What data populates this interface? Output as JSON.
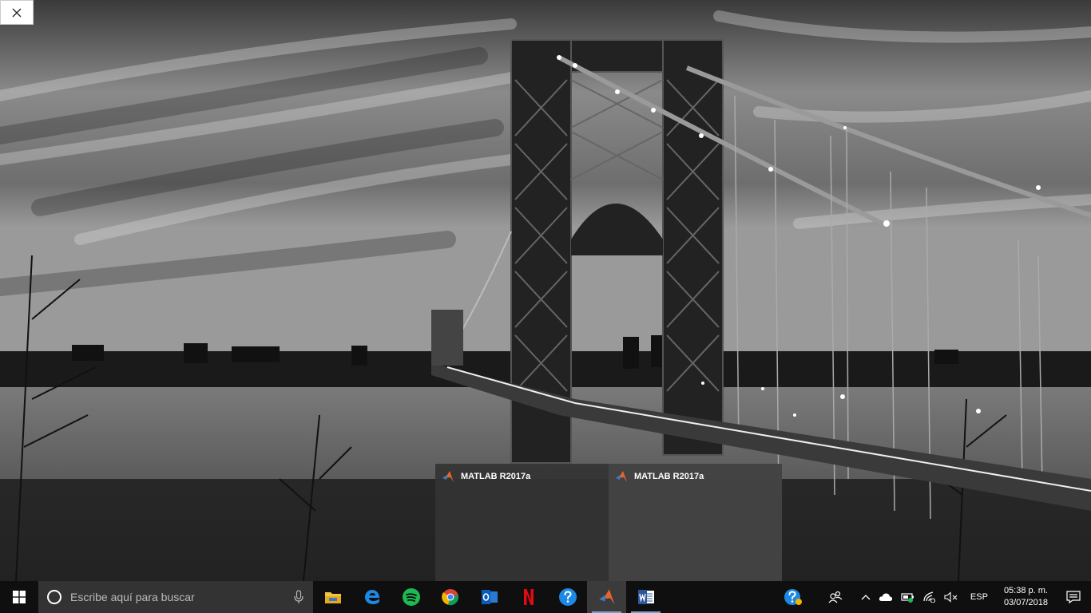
{
  "wallpaper": {
    "description_icon": "bridge-wallpaper"
  },
  "close_button": {
    "icon": "close-icon"
  },
  "thumbnails": [
    {
      "title": "MATLAB R2017a",
      "icon": "matlab-icon"
    },
    {
      "title": "MATLAB R2017a",
      "icon": "matlab-icon"
    }
  ],
  "taskbar": {
    "search_placeholder": "Escribe aquí para buscar",
    "apps": [
      {
        "name": "file-explorer",
        "icon": "folder-icon",
        "running": false
      },
      {
        "name": "edge",
        "icon": "edge-icon",
        "running": false
      },
      {
        "name": "spotify",
        "icon": "spotify-icon",
        "running": false
      },
      {
        "name": "chrome",
        "icon": "chrome-icon",
        "running": false
      },
      {
        "name": "outlook",
        "icon": "outlook-icon",
        "running": false
      },
      {
        "name": "netflix",
        "icon": "netflix-icon",
        "running": false
      },
      {
        "name": "help",
        "icon": "help-icon",
        "running": false
      },
      {
        "name": "matlab",
        "icon": "matlab-icon",
        "running": true,
        "active": true
      },
      {
        "name": "word",
        "icon": "word-icon",
        "running": true
      }
    ],
    "tray": {
      "language": "ESP",
      "time": "05:38 p. m.",
      "date": "03/07/2018"
    }
  },
  "colors": {
    "taskbar_bg": "#0f0f0f",
    "search_bg": "#333333",
    "running_indicator": "#7aa0d0"
  }
}
